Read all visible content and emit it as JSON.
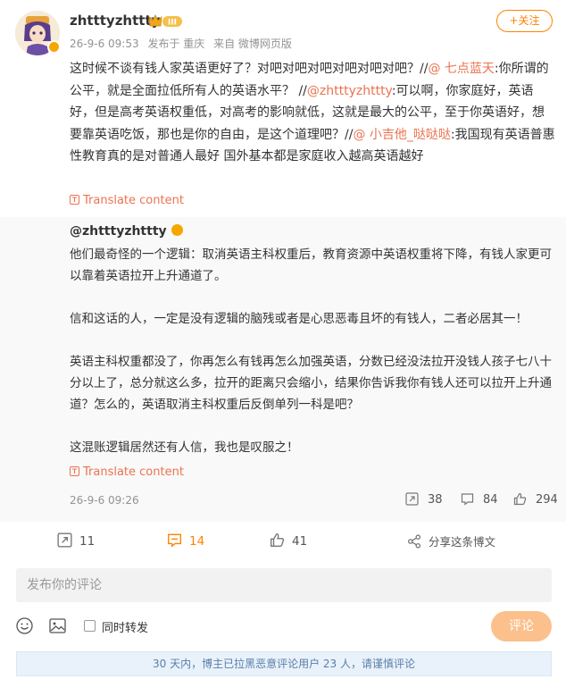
{
  "post": {
    "username": "zhtttyzhttty",
    "member_level": "III",
    "timestamp": "26-9-6 09:53",
    "location": "发布于 重庆",
    "source": "来自 微博网页版",
    "follow_label": "+关注",
    "text_parts": [
      {
        "type": "text",
        "value": "这时候不谈有钱人家英语更好了？对吧对吧对吧对吧对吧对吧？//"
      },
      {
        "type": "mention",
        "value": "@ 七点蓝天"
      },
      {
        "type": "text",
        "value": ":你所谓的公平，就是全面拉低所有人的英语水平？ //"
      },
      {
        "type": "mention",
        "value": "@zhtttyzhttty"
      },
      {
        "type": "text",
        "value": ":可以啊，你家庭好，英语好，但是高考英语权重低，对高考的影响就低，这就是最大的公平，至于你英语好，想要靠英语吃饭，那也是你的自由，是这个道理吧？//"
      },
      {
        "type": "mention",
        "value": "@ 小吉他_哒哒哒"
      },
      {
        "type": "text",
        "value": ":我国现有英语普惠性教育真的是对普通人最好 国外基本都是家庭收入越高英语越好"
      }
    ],
    "translate_label": "Translate content"
  },
  "repost": {
    "username": "@zhtttyzhttty",
    "paragraphs": [
      "他们最奇怪的一个逻辑：取消英语主科权重后，教育资源中英语权重将下降，有钱人家更可以靠着英语拉开上升通道了。",
      "信和这话的人，一定是没有逻辑的脑残或者是心思恶毒且坏的有钱人，二者必居其一！",
      "英语主科权重都没了，你再怎么有钱再怎么加强英语，分数已经没法拉开没钱人孩子七八十分以上了，总分就这么多，拉开的距离只会缩小，结果你告诉我你有钱人还可以拉开上升通道？怎么的，英语取消主科权重后反倒单列一科是吧？",
      "这混账逻辑居然还有人信，我也是叹服之！"
    ],
    "translate_label": "Translate content",
    "timestamp": "26-9-6 09:26",
    "stats": {
      "reposts": "38",
      "comments": "84",
      "likes": "294"
    }
  },
  "actions": {
    "reposts": "11",
    "comments": "14",
    "likes": "41",
    "share_label": "分享这条博文"
  },
  "comment_box": {
    "placeholder": "发布你的评论",
    "repost_checkbox_label": "同时转发",
    "submit_label": "评论"
  },
  "notice": "30 天内，博主已拉黑恶意评论用户 23 人，请谨慎评论",
  "colors": {
    "accent": "#ff8200",
    "mention": "#eb7350",
    "notice_bg": "#e9f2fb",
    "notice_text": "#5a7fa8"
  }
}
